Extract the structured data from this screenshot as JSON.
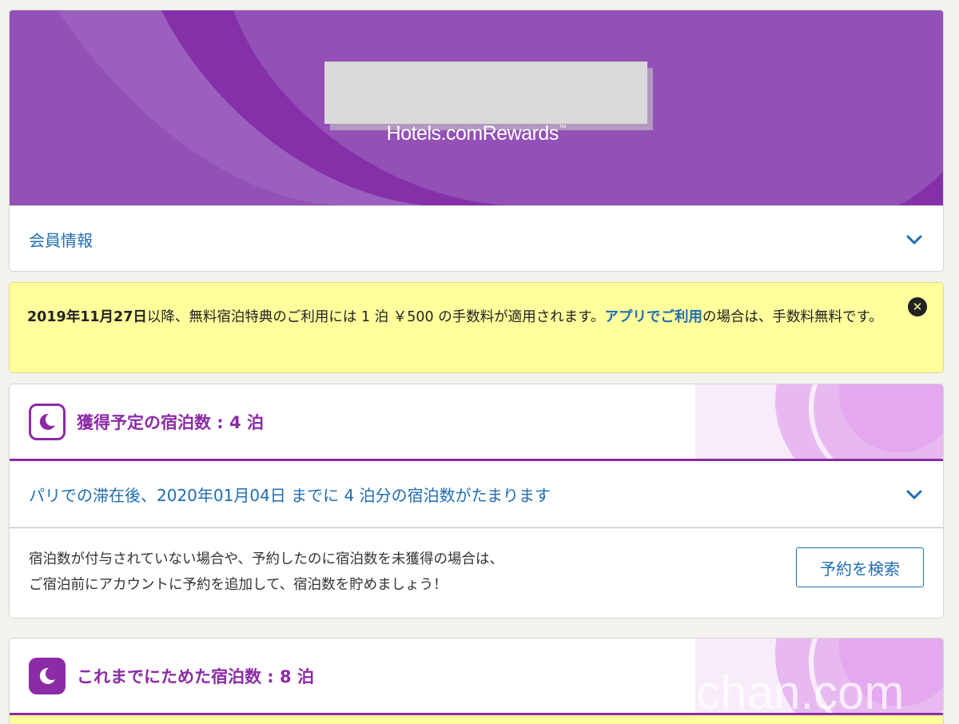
{
  "rewards": {
    "brand": "Hotels.comRewards",
    "brand_tm": "™",
    "member_info_label": "会員情報"
  },
  "notice": {
    "date": "2019年11月27日",
    "text_before_link": "以降、無料宿泊特典のご利用には 1 泊 ￥500 の手数料が適用されます。",
    "link": "アプリでご利用",
    "text_after_link": "の場合は、手数料無料です。",
    "close_glyph": "✕"
  },
  "pending_nights": {
    "title": "獲得予定の宿泊数 : 4 泊",
    "stay_summary": "パリでの滞在後、2020年01月04日 までに 4 泊分の宿泊数がたまります",
    "add_line_1": "宿泊数が付与されていない場合や、予約したのに宿泊数を未獲得の場合は、",
    "add_line_2": "ご宿泊前にアカウントに予約を追加して、宿泊数を貯めましょう！",
    "search_button": "予約を検索"
  },
  "earned_nights": {
    "title": "これまでにためた宿泊数 : 8 泊"
  },
  "watermark": "ichan.com",
  "colors": {
    "purple": "#8c2ba6",
    "banner": "#9351b7",
    "link_blue": "#1f6db2",
    "notice_yellow": "#ffff9c"
  },
  "icons": [
    "chevron-down-icon",
    "close-icon",
    "moon-icon"
  ]
}
